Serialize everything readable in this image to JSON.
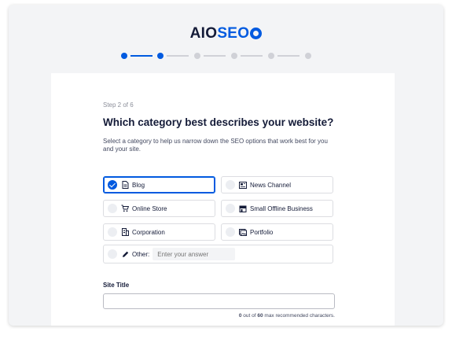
{
  "logo": {
    "aio": "AIO",
    "seo": "SEO"
  },
  "wizard": {
    "step_label": "Step 2 of 6",
    "title": "Which category best describes your website?",
    "description": "Select a category to help us narrow down the SEO options that work best for you and your site."
  },
  "categories": [
    {
      "label": "Blog",
      "icon": "document-icon",
      "selected": true
    },
    {
      "label": "News Channel",
      "icon": "newspaper-icon",
      "selected": false
    },
    {
      "label": "Online Store",
      "icon": "cart-icon",
      "selected": false
    },
    {
      "label": "Small Offline Business",
      "icon": "store-icon",
      "selected": false
    },
    {
      "label": "Corporation",
      "icon": "building-icon",
      "selected": false
    },
    {
      "label": "Portfolio",
      "icon": "image-icon",
      "selected": false
    }
  ],
  "other": {
    "label": "Other:",
    "placeholder": "Enter your answer"
  },
  "site_title": {
    "label": "Site Title",
    "value": "",
    "count": "0",
    "count_middle": " out of ",
    "max": "60",
    "count_suffix": " max recommended characters."
  },
  "colors": {
    "accent": "#005ae0",
    "text": "#141b38",
    "muted": "#8c8f9a"
  }
}
